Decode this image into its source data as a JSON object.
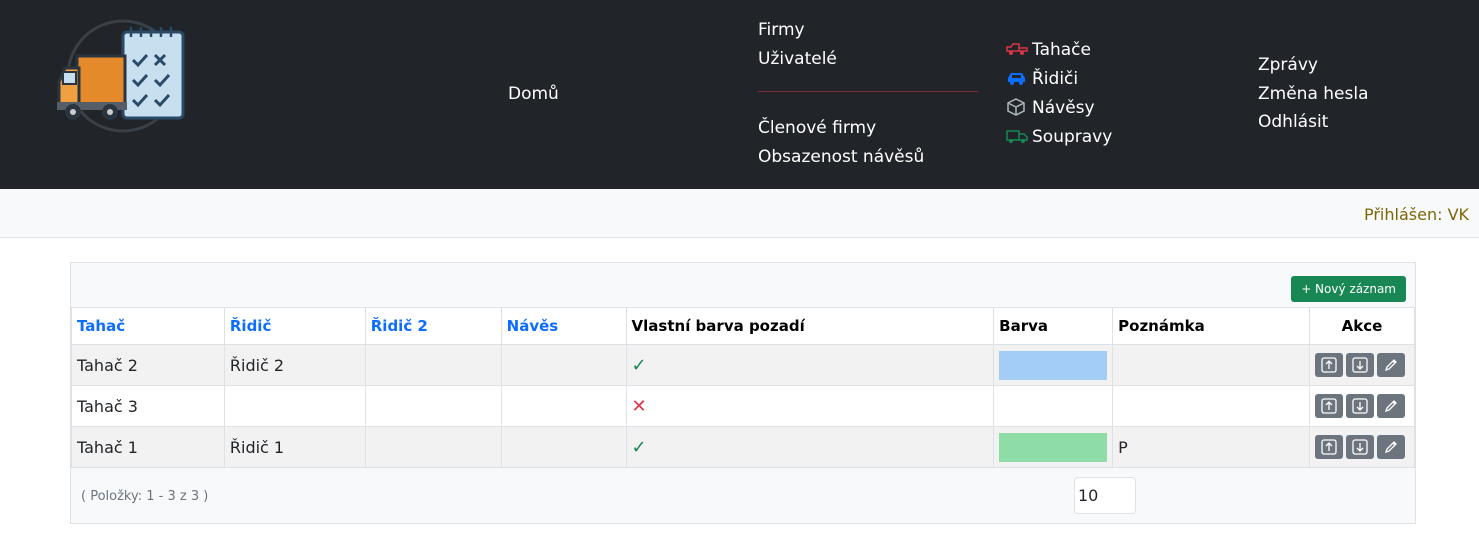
{
  "nav": {
    "home": "Domů",
    "firms": "Firmy",
    "users": "Uživatelé",
    "member_firms": "Členové firmy",
    "trailer_occupancy": "Obsazenost návěsů",
    "tractors": "Tahače",
    "drivers": "Řidiči",
    "trailers": "Návěsy",
    "sets": "Soupravy",
    "messages": "Zprávy",
    "change_password": "Změna hesla",
    "logout": "Odhlásit",
    "icon_colors": {
      "tractors": "#dc3545",
      "drivers": "#0d6efd",
      "trailers": "#adb5bd",
      "sets": "#198754"
    }
  },
  "status": {
    "logged_in": "Přihlášen: VK"
  },
  "grid": {
    "new_record": "+  Nový záznam",
    "columns": [
      "Tahač",
      "Řidič",
      "Řidič 2",
      "Návěs",
      "Vlastní barva pozadí",
      "Barva",
      "Poznámka",
      "Akce"
    ],
    "rows": [
      {
        "tractor": "Tahač 2",
        "driver": "Řidič 2",
        "driver2": "",
        "trailer": "",
        "own_color": true,
        "color": "#a3cdf7",
        "note": ""
      },
      {
        "tractor": "Tahač 3",
        "driver": "",
        "driver2": "",
        "trailer": "",
        "own_color": false,
        "color": "",
        "note": ""
      },
      {
        "tractor": "Tahač 1",
        "driver": "Řidič 1",
        "driver2": "",
        "trailer": "",
        "own_color": true,
        "color": "#8edca6",
        "note": "P"
      }
    ],
    "pager_info": "( Položky: 1 - 3 z 3 )",
    "page_size": "10"
  }
}
